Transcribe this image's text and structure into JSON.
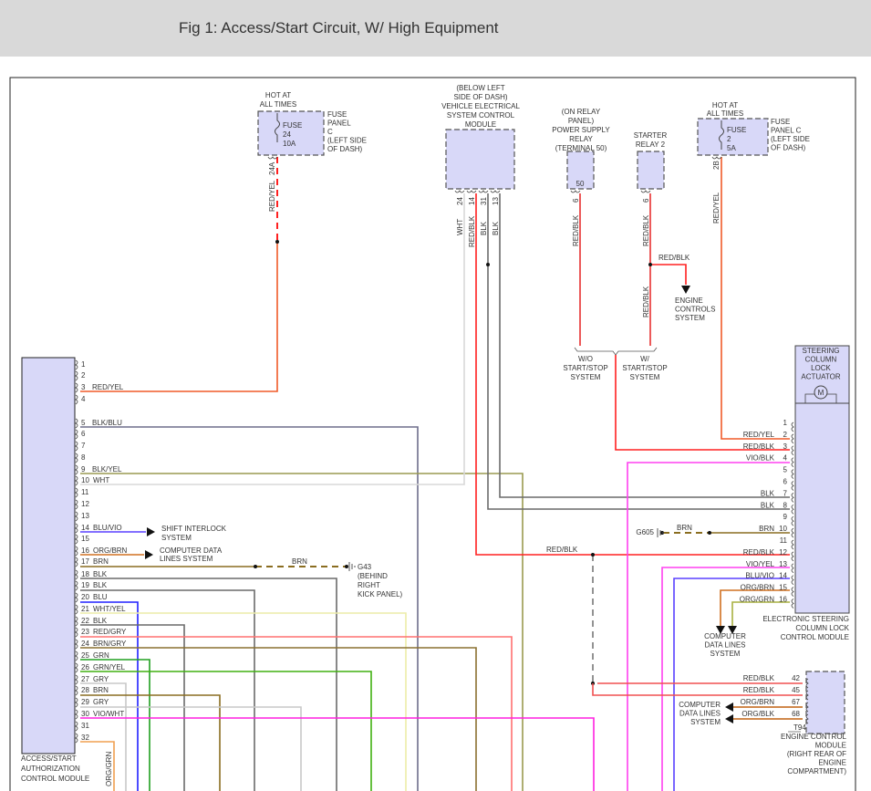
{
  "title": "Fig 1: Access/Start Circuit, W/ High Equipment",
  "fuse_24": {
    "header": [
      "HOT AT",
      "ALL TIMES"
    ],
    "fuse": [
      "FUSE",
      "24",
      "10A"
    ],
    "location": [
      "FUSE",
      "PANEL",
      "C",
      "(LEFT SIDE",
      "OF DASH)"
    ],
    "circuit": "24A",
    "wire": "RED/YEL"
  },
  "vescm": {
    "label": [
      "(BELOW LEFT",
      "SIDE OF DASH)",
      "VEHICLE ELECTRICAL",
      "SYSTEM CONTROL",
      "MODULE"
    ],
    "pins": [
      {
        "num": "24",
        "color": "WHT"
      },
      {
        "num": "14",
        "color": "RED/BLK"
      },
      {
        "num": "31",
        "color": "BLK"
      },
      {
        "num": "13",
        "color": "BLK"
      }
    ]
  },
  "power_relay": {
    "label": [
      "(ON RELAY",
      "PANEL)",
      "POWER SUPPLY",
      "RELAY",
      "(TERMINAL 50)"
    ],
    "terminal": "50",
    "pin": "6",
    "wire": "RED/BLK"
  },
  "starter_relay": {
    "label": [
      "STARTER",
      "RELAY 2"
    ],
    "pin": "6",
    "wire": "RED/BLK",
    "wire_lower": "RED/BLK",
    "branch_wire": "RED/BLK",
    "branch_dest": [
      "ENGINE",
      "CONTROLS",
      "SYSTEM"
    ]
  },
  "start_stop": {
    "without": [
      "W/O",
      "START/STOP",
      "SYSTEM"
    ],
    "with": [
      "W/",
      "START/STOP",
      "SYSTEM"
    ]
  },
  "fuse_2": {
    "header": [
      "HOT AT",
      "ALL TIMES"
    ],
    "fuse": [
      "FUSE",
      "2",
      "5A"
    ],
    "location": [
      "FUSE",
      "PANEL C",
      "(LEFT SIDE",
      "OF DASH)"
    ],
    "circuit": "2B",
    "wire": "RED/YEL"
  },
  "left_module": {
    "label": [
      "ACCESS/START",
      "AUTHORIZATION",
      "CONTROL MODULE"
    ],
    "pins": [
      {
        "num": "1",
        "color": ""
      },
      {
        "num": "2",
        "color": ""
      },
      {
        "num": "3",
        "color": "RED/YEL"
      },
      {
        "num": "4",
        "color": ""
      },
      {
        "num": "5",
        "color": "BLK/BLU"
      },
      {
        "num": "6",
        "color": ""
      },
      {
        "num": "7",
        "color": ""
      },
      {
        "num": "8",
        "color": ""
      },
      {
        "num": "9",
        "color": "BLK/YEL"
      },
      {
        "num": "10",
        "color": "WHT"
      },
      {
        "num": "11",
        "color": ""
      },
      {
        "num": "12",
        "color": ""
      },
      {
        "num": "13",
        "color": ""
      },
      {
        "num": "14",
        "color": "BLU/VIO"
      },
      {
        "num": "15",
        "color": ""
      },
      {
        "num": "16",
        "color": "ORG/BRN"
      },
      {
        "num": "17",
        "color": "BRN"
      },
      {
        "num": "18",
        "color": "BLK"
      },
      {
        "num": "19",
        "color": "BLK"
      },
      {
        "num": "20",
        "color": "BLU"
      },
      {
        "num": "21",
        "color": "WHT/YEL"
      },
      {
        "num": "22",
        "color": "BLK"
      },
      {
        "num": "23",
        "color": "RED/GRY"
      },
      {
        "num": "24",
        "color": "BRN/GRY"
      },
      {
        "num": "25",
        "color": "GRN"
      },
      {
        "num": "26",
        "color": "GRN/YEL"
      },
      {
        "num": "27",
        "color": "GRY"
      },
      {
        "num": "28",
        "color": "BRN"
      },
      {
        "num": "29",
        "color": "GRY"
      },
      {
        "num": "30",
        "color": "VIO/WHT"
      },
      {
        "num": "31",
        "color": ""
      },
      {
        "num": "32",
        "color": ""
      }
    ],
    "pin32_wire": "ORG/GRN",
    "shift_interlock": [
      "SHIFT INTERLOCK",
      "SYSTEM"
    ],
    "computer_data": [
      "COMPUTER DATA",
      "LINES SYSTEM"
    ],
    "ground_wire": "BRN",
    "ground": [
      "G43",
      "(BEHIND",
      "RIGHT",
      "KICK PANEL)"
    ]
  },
  "mid_splice_wire": "RED/BLK",
  "actuator": {
    "label": [
      "STEERING",
      "COLUMN",
      "LOCK",
      "ACTUATOR"
    ],
    "motor": "M"
  },
  "right_module": {
    "label": [
      "ELECTRONIC STEERING",
      "COLUMN LOCK",
      "CONTROL MODULE"
    ],
    "pins": [
      {
        "num": "1",
        "color": ""
      },
      {
        "num": "2",
        "color": "RED/YEL"
      },
      {
        "num": "3",
        "color": "RED/BLK"
      },
      {
        "num": "4",
        "color": "VIO/BLK"
      },
      {
        "num": "5",
        "color": ""
      },
      {
        "num": "6",
        "color": ""
      },
      {
        "num": "7",
        "color": "BLK"
      },
      {
        "num": "8",
        "color": "BLK"
      },
      {
        "num": "9",
        "color": ""
      },
      {
        "num": "10",
        "color": "BRN"
      },
      {
        "num": "11",
        "color": ""
      },
      {
        "num": "12",
        "color": "RED/BLK"
      },
      {
        "num": "13",
        "color": "VIO/YEL"
      },
      {
        "num": "14",
        "color": "BLU/VIO"
      },
      {
        "num": "15",
        "color": "ORG/BRN"
      },
      {
        "num": "16",
        "color": "ORG/GRN"
      }
    ],
    "ground": "G605",
    "ground_wire": "BRN",
    "data_dest": [
      "COMPUTER",
      "DATA LINES",
      "SYSTEM"
    ]
  },
  "ecm": {
    "label": [
      "ENGINE CONTROL",
      "MODULE",
      "(RIGHT REAR OF",
      "ENGINE",
      "COMPARTMENT)"
    ],
    "connector": "T94",
    "pins": [
      {
        "num": "42",
        "color": "RED/BLK"
      },
      {
        "num": "45",
        "color": "RED/BLK"
      },
      {
        "num": "67",
        "color": "ORG/BRN"
      },
      {
        "num": "68",
        "color": "ORG/BLK"
      }
    ],
    "data_dest": [
      "COMPUTER",
      "DATA LINES",
      "SYSTEM"
    ]
  },
  "colors": {
    "module_fill": "#d8d8f8",
    "header_bg": "#d9d9d9"
  }
}
